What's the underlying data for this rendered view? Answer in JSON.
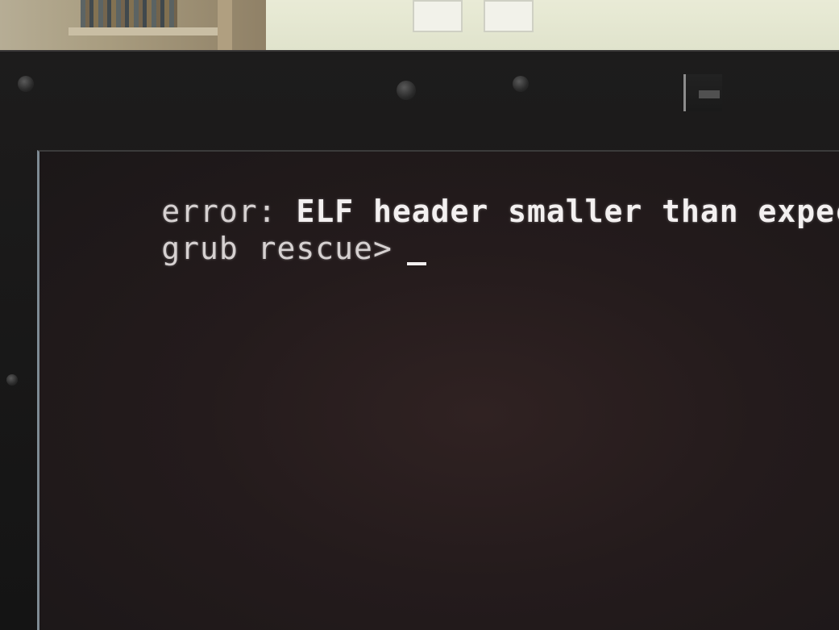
{
  "terminal": {
    "error_line": {
      "prefix": "error:",
      "message": " ELF header smaller than expected."
    },
    "prompt": {
      "text": "grub rescue>"
    }
  }
}
